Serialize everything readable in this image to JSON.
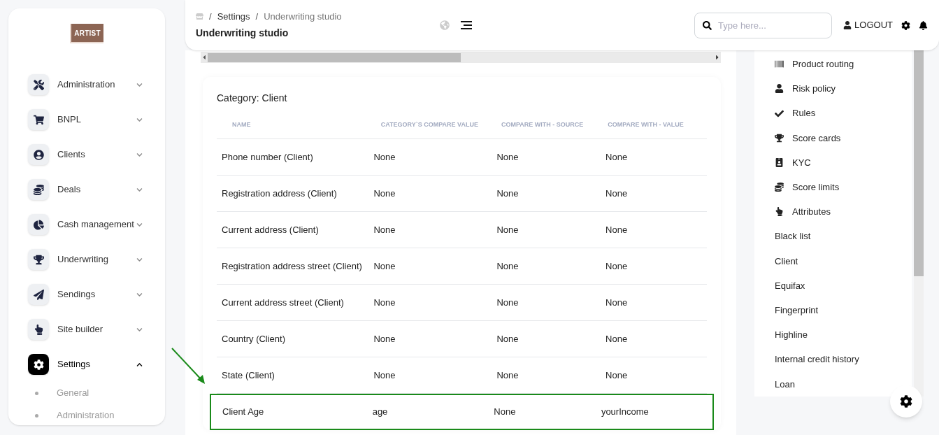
{
  "sidebar": {
    "logo": "ARTIST",
    "items": [
      {
        "label": "Administration",
        "expanded": false,
        "selected": false
      },
      {
        "label": "BNPL",
        "expanded": false,
        "selected": false
      },
      {
        "label": "Clients",
        "expanded": false,
        "selected": false
      },
      {
        "label": "Deals",
        "expanded": false,
        "selected": false
      },
      {
        "label": "Cash management",
        "expanded": false,
        "selected": false
      },
      {
        "label": "Underwriting",
        "expanded": false,
        "selected": false
      },
      {
        "label": "Sendings",
        "expanded": false,
        "selected": false
      },
      {
        "label": "Site builder",
        "expanded": false,
        "selected": false
      },
      {
        "label": "Settings",
        "expanded": true,
        "selected": true,
        "children": [
          {
            "label": "General"
          },
          {
            "label": "Administration"
          }
        ]
      }
    ]
  },
  "header": {
    "separator": "/",
    "breadcrumb": [
      "Settings",
      "Underwriting studio"
    ],
    "title": "Underwriting studio",
    "search": {
      "placeholder": "Type here..."
    },
    "logout": "LOGOUT"
  },
  "card": {
    "title": "Category: Client",
    "table": {
      "columns": [
        "NAME",
        "CATEGORY`S COMPARE VALUE",
        "COMPARE WITH - SOURCE",
        "COMPARE WITH - VALUE"
      ],
      "rows": [
        {
          "cells": [
            "Phone number (Client)",
            "None",
            "None",
            "None"
          ],
          "highlighted": false
        },
        {
          "cells": [
            "Registration address (Client)",
            "None",
            "None",
            "None"
          ],
          "highlighted": false
        },
        {
          "cells": [
            "Current address (Client)",
            "None",
            "None",
            "None"
          ],
          "highlighted": false
        },
        {
          "cells": [
            "Registration address street (Client)",
            "None",
            "None",
            "None"
          ],
          "highlighted": false
        },
        {
          "cells": [
            "Current address street (Client)",
            "None",
            "None",
            "None"
          ],
          "highlighted": false
        },
        {
          "cells": [
            "Country (Client)",
            "None",
            "None",
            "None"
          ],
          "highlighted": false
        },
        {
          "cells": [
            "State (Client)",
            "None",
            "None",
            "None"
          ],
          "highlighted": false
        },
        {
          "cells": [
            "Client Age",
            "age",
            "None",
            "yourIncome"
          ],
          "highlighted": true
        }
      ]
    }
  },
  "right_panel": {
    "items": [
      {
        "label": "Product routing",
        "kind": "icon"
      },
      {
        "label": "Risk policy",
        "kind": "icon"
      },
      {
        "label": "Rules",
        "kind": "icon"
      },
      {
        "label": "Score cards",
        "kind": "icon"
      },
      {
        "label": "KYC",
        "kind": "icon"
      },
      {
        "label": "Score limits",
        "kind": "icon"
      },
      {
        "label": "Attributes",
        "kind": "icon"
      },
      {
        "label": "Black list",
        "kind": "plain"
      },
      {
        "label": "Client",
        "kind": "plain"
      },
      {
        "label": "Equifax",
        "kind": "plain"
      },
      {
        "label": "Fingerprint",
        "kind": "plain"
      },
      {
        "label": "Highline",
        "kind": "plain"
      },
      {
        "label": "Internal credit history",
        "kind": "plain"
      },
      {
        "label": "Loan",
        "kind": "plain"
      }
    ]
  }
}
